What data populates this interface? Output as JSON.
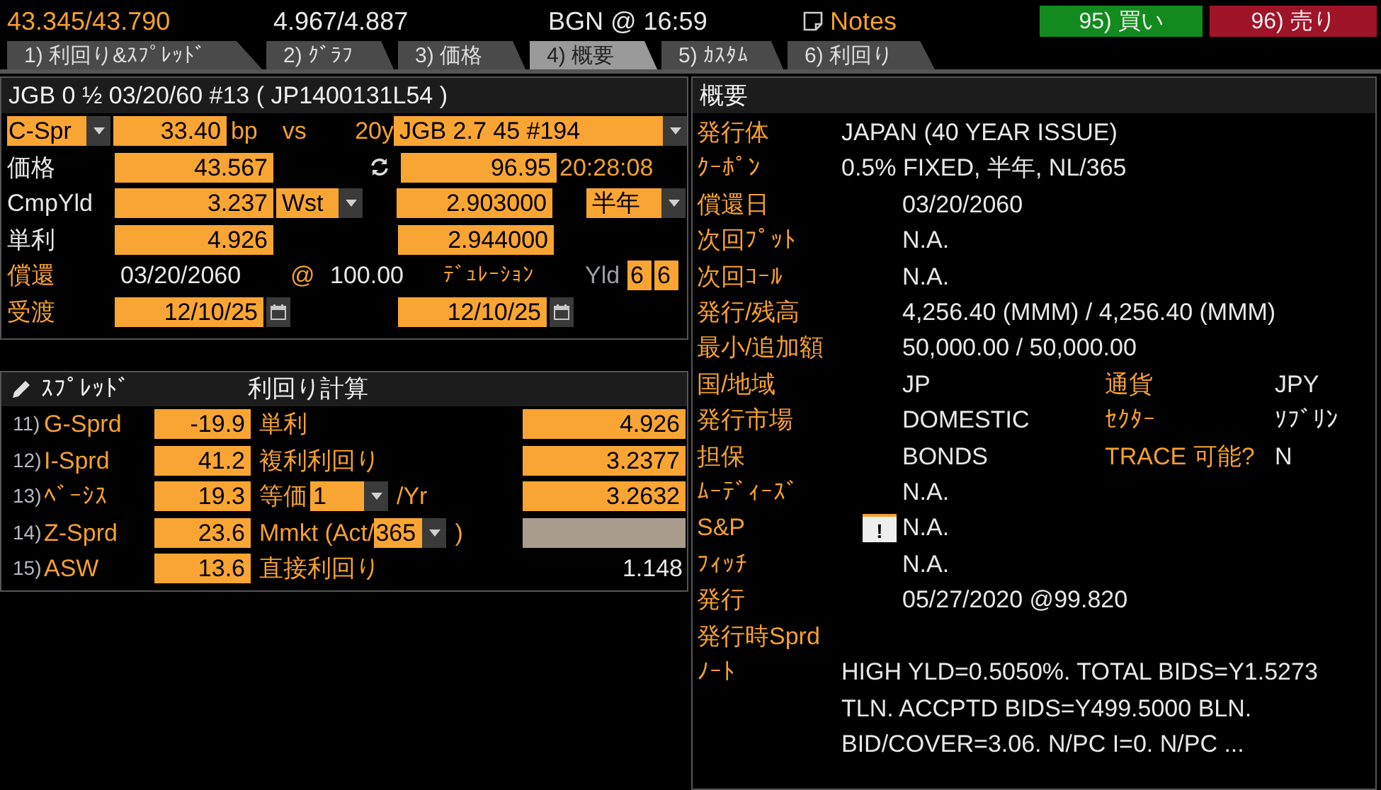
{
  "header": {
    "bid_ask": "43.345/43.790",
    "yields": "4.967/4.887",
    "source": "BGN @ 16:59",
    "notes": "Notes",
    "buy": "95) 買い",
    "sell": "96) 売り"
  },
  "tabs": [
    {
      "label": "1) 利回り&ｽﾌﾟﾚｯﾄﾞ",
      "selected": false
    },
    {
      "label": "2) ｸﾞﾗﾌ",
      "selected": false
    },
    {
      "label": "3) 価格",
      "selected": false
    },
    {
      "label": "4) 概要",
      "selected": true
    },
    {
      "label": "5) ｶｽﾀﾑ",
      "selected": false
    },
    {
      "label": "6) 利回り",
      "selected": false
    }
  ],
  "security": {
    "title": "JGB 0 ½ 03/20/60 #13 ( JP1400131L54 )"
  },
  "pricing": {
    "spread_type": "C-Spr",
    "spread": "33.40",
    "spread_unit": "bp",
    "vs": "vs",
    "benchmark_tenor": "20y",
    "benchmark": "JGB 2.7 45 #194",
    "price_label": "価格",
    "price": "43.567",
    "bench_price": "96.95",
    "bench_time": "20:28:08",
    "yield_label": "CmpYld",
    "yield": "3.237",
    "yield_type": "Wst",
    "bench_yield": "2.903000",
    "frequency": "半年",
    "simple_label": "単利",
    "simple": "4.926",
    "bench_simple": "2.944000",
    "maturity_label": "償還",
    "maturity": "03/20/2060",
    "at": "@",
    "redemption": "100.00",
    "duration_label": "ﾃﾞｭﾚｰｼｮﾝ",
    "yld_label": "Yld",
    "yld_digits": [
      "6",
      "6"
    ],
    "settle_label": "受渡",
    "settle": "12/10/25",
    "bench_settle": "12/10/25"
  },
  "spreads": {
    "title": "ｽﾌﾟﾚｯﾄﾞ",
    "rows": [
      {
        "num": "11)",
        "label": "G-Sprd",
        "value": "-19.9"
      },
      {
        "num": "12)",
        "label": "I-Sprd",
        "value": "41.2"
      },
      {
        "num": "13)",
        "label": "ﾍﾞｰｼｽ",
        "value": "19.3"
      },
      {
        "num": "14)",
        "label": "Z-Sprd",
        "value": "23.6"
      },
      {
        "num": "15)",
        "label": "ASW",
        "value": "13.6"
      }
    ]
  },
  "yield_calc": {
    "title": "利回り計算",
    "rows": [
      {
        "kind": "field",
        "label": "単利",
        "value": "4.926"
      },
      {
        "kind": "field",
        "label": "複利利回り",
        "value": "3.2377"
      },
      {
        "kind": "select",
        "label": "等価",
        "select": "1",
        "suffix": "/Yr",
        "value": "3.2632"
      },
      {
        "kind": "blank",
        "label": "Mmkt (Act/",
        "select": "365",
        "suffix": ")"
      },
      {
        "kind": "text",
        "label": "直接利回り",
        "value": "1.148"
      }
    ]
  },
  "overview": {
    "title": "概要",
    "rows": [
      {
        "kind": "near",
        "label": "発行体",
        "value": "JAPAN (40 YEAR ISSUE)"
      },
      {
        "kind": "near",
        "label": "ｸｰﾎﾟﾝ",
        "value": "0.5% FIXED, 半年, NL/365"
      },
      {
        "kind": "single",
        "label": "償還日",
        "value": "03/20/2060"
      },
      {
        "kind": "single",
        "label": "次回ﾌﾟｯﾄ",
        "value": "N.A."
      },
      {
        "kind": "single",
        "label": "次回ｺｰﾙ",
        "value": "N.A."
      },
      {
        "kind": "single",
        "label": "発行/残高",
        "value": "4,256.40 (MMM) / 4,256.40 (MMM)"
      },
      {
        "kind": "single",
        "label": "最小/追加額",
        "value": "50,000.00 / 50,000.00"
      },
      {
        "kind": "pair",
        "label": "国/地域",
        "value": "JP",
        "label2": "通貨",
        "value2": "JPY"
      },
      {
        "kind": "pair",
        "label": "発行市場",
        "value": "DOMESTIC",
        "label2": "ｾｸﾀｰ",
        "value2": "ｿﾌﾞﾘﾝ"
      },
      {
        "kind": "pair",
        "label": "担保",
        "value": "BONDS",
        "label2": "TRACE 可能?",
        "value2": "N"
      },
      {
        "kind": "single",
        "label": "ﾑｰﾃﾞｨｰｽﾞ",
        "value": "N.A."
      },
      {
        "kind": "single",
        "label": "S&P",
        "flag": "!",
        "value": "N.A."
      },
      {
        "kind": "single",
        "label": "ﾌｨｯﾁ",
        "value": "N.A."
      },
      {
        "kind": "single",
        "label": "発行",
        "value": "05/27/2020 @99.820"
      },
      {
        "kind": "single",
        "label": "発行時Sprd"
      },
      {
        "kind": "note",
        "label": "ﾉｰﾄ",
        "lines": [
          "HIGH YLD=0.5050%. TOTAL BIDS=Y1.5273",
          "TLN. ACCPTD BIDS=Y499.5000 BLN.",
          "BID/COVER=3.06. N/PC I=0. N/PC ..."
        ]
      }
    ]
  }
}
